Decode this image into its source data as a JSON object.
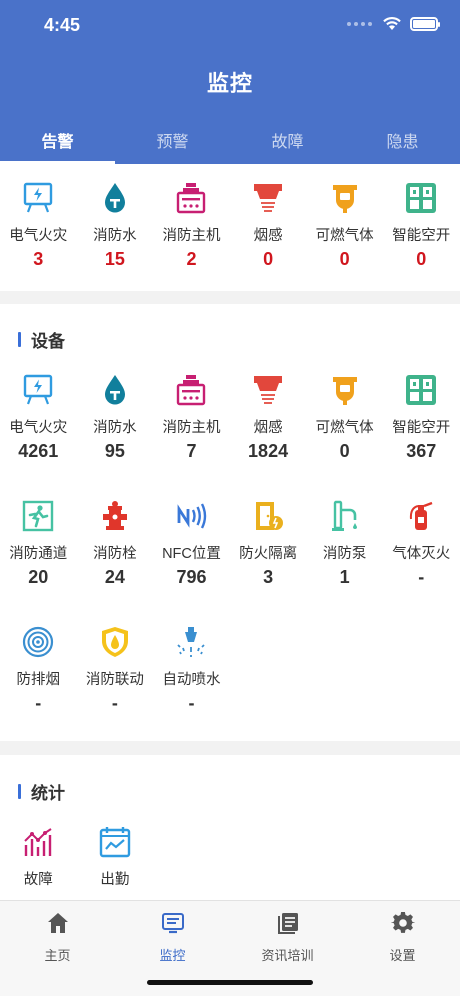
{
  "status_bar": {
    "time": "4:45"
  },
  "header": {
    "title": "监控"
  },
  "tabs": [
    {
      "label": "告警",
      "active": true
    },
    {
      "label": "预警",
      "active": false
    },
    {
      "label": "故障",
      "active": false
    },
    {
      "label": "隐患",
      "active": false
    }
  ],
  "alarm": {
    "items": [
      {
        "label": "电气火灾",
        "count": "3",
        "icon": "electrical-fire-icon"
      },
      {
        "label": "消防水",
        "count": "15",
        "icon": "fire-water-icon"
      },
      {
        "label": "消防主机",
        "count": "2",
        "icon": "fire-host-icon"
      },
      {
        "label": "烟感",
        "count": "0",
        "icon": "smoke-detector-icon"
      },
      {
        "label": "可燃气体",
        "count": "0",
        "icon": "combustible-gas-icon"
      },
      {
        "label": "智能空开",
        "count": "0",
        "icon": "smart-breaker-icon"
      }
    ]
  },
  "devices": {
    "title": "设备",
    "items": [
      {
        "label": "电气火灾",
        "count": "4261",
        "icon": "electrical-fire-icon"
      },
      {
        "label": "消防水",
        "count": "95",
        "icon": "fire-water-icon"
      },
      {
        "label": "消防主机",
        "count": "7",
        "icon": "fire-host-icon"
      },
      {
        "label": "烟感",
        "count": "1824",
        "icon": "smoke-detector-icon"
      },
      {
        "label": "可燃气体",
        "count": "0",
        "icon": "combustible-gas-icon"
      },
      {
        "label": "智能空开",
        "count": "367",
        "icon": "smart-breaker-icon"
      },
      {
        "label": "消防通道",
        "count": "20",
        "icon": "fire-exit-icon"
      },
      {
        "label": "消防栓",
        "count": "24",
        "icon": "fire-hydrant-icon"
      },
      {
        "label": "NFC位置",
        "count": "796",
        "icon": "nfc-icon"
      },
      {
        "label": "防火隔离",
        "count": "3",
        "icon": "fire-door-icon"
      },
      {
        "label": "消防泵",
        "count": "1",
        "icon": "fire-pump-icon"
      },
      {
        "label": "气体灭火",
        "count": "-",
        "icon": "gas-extinguisher-icon"
      },
      {
        "label": "防排烟",
        "count": "-",
        "icon": "smoke-exhaust-icon"
      },
      {
        "label": "消防联动",
        "count": "-",
        "icon": "fire-linkage-icon"
      },
      {
        "label": "自动喷水",
        "count": "-",
        "icon": "sprinkler-icon"
      }
    ]
  },
  "stats": {
    "title": "统计",
    "items": [
      {
        "label": "故障",
        "icon": "fault-chart-icon"
      },
      {
        "label": "出勤",
        "icon": "attendance-icon"
      }
    ]
  },
  "tabbar": [
    {
      "label": "主页",
      "icon": "home-icon",
      "active": false
    },
    {
      "label": "监控",
      "icon": "monitor-icon",
      "active": true
    },
    {
      "label": "资讯培训",
      "icon": "news-icon",
      "active": false
    },
    {
      "label": "设置",
      "icon": "gear-icon",
      "active": false
    }
  ],
  "colors": {
    "header_blue": "#4a72c9",
    "alarm_red": "#d0161e",
    "section_accent": "#3a6fd8",
    "tabbar_active": "#3a6ac8"
  }
}
